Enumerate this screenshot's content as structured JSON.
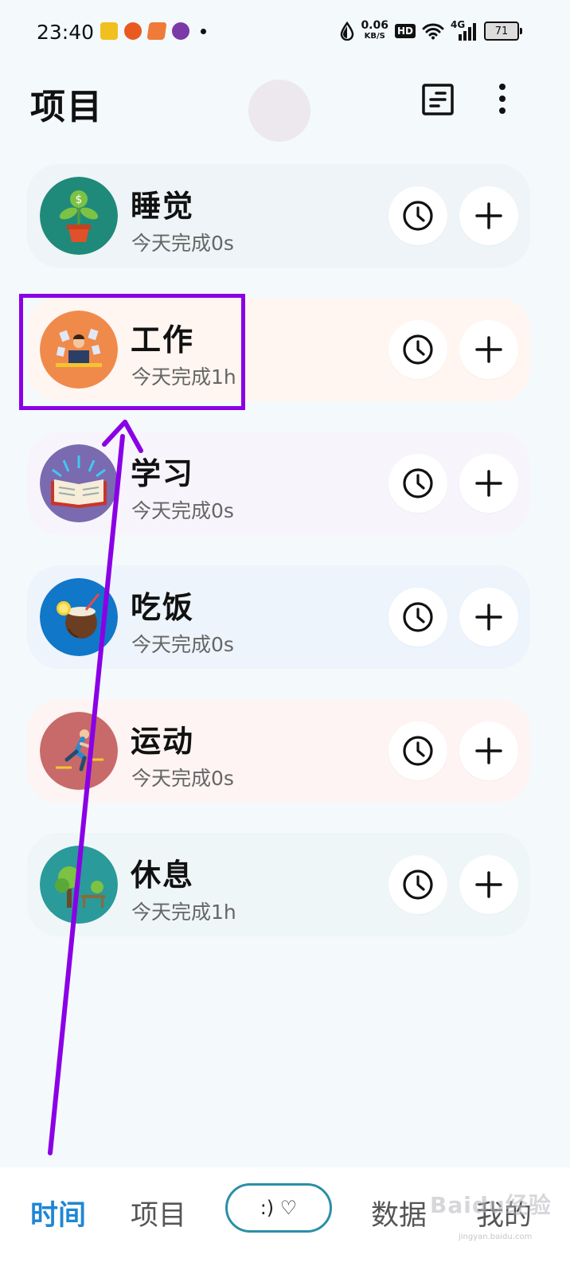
{
  "status_bar": {
    "time": "23:40",
    "net_speed": "0.06",
    "net_unit": "KB/S",
    "hd": "HD",
    "network": "4G",
    "battery": "71"
  },
  "header": {
    "title": "项目"
  },
  "projects": [
    {
      "name": "睡觉",
      "today": "今天完成0s",
      "bg": "#eef4f7",
      "icon_bg": "#1f8a7a"
    },
    {
      "name": "工作",
      "today": "今天完成1h",
      "bg": "#fff6f1",
      "icon_bg": "#f08a4b"
    },
    {
      "name": "学习",
      "today": "今天完成0s",
      "bg": "#f7f5fb",
      "icon_bg": "#7a6ab0"
    },
    {
      "name": "吃饭",
      "today": "今天完成0s",
      "bg": "#edf4fb",
      "icon_bg": "#1177c8"
    },
    {
      "name": "运动",
      "today": "今天完成0s",
      "bg": "#fdf4f3",
      "icon_bg": "#c86a6a"
    },
    {
      "name": "休息",
      "today": "今天完成1h",
      "bg": "#eff6f8",
      "icon_bg": "#2a9a9a"
    }
  ],
  "bottom_nav": {
    "time": "时间",
    "projects": "项目",
    "center": ":) ♡",
    "data": "数据",
    "mine": "我的"
  },
  "watermark": {
    "text": "Baidu经验",
    "sub": "jingyan.baidu.com"
  },
  "colors": {
    "accent": "#1f86d6",
    "highlight": "#8a00e6"
  }
}
